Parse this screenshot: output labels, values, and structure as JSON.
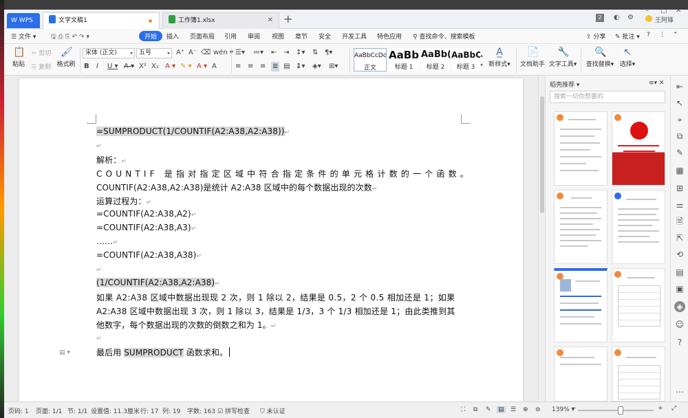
{
  "titlebar": {
    "app_tab": "WPS",
    "tabs": [
      {
        "label": "文字文稿1",
        "active": true
      },
      {
        "label": "工作簿1.xlsx",
        "active": false
      }
    ],
    "page_count_badge": "2",
    "user_name": "王阿锋"
  },
  "menubar": {
    "file_label": "文件",
    "items": [
      "开始",
      "插入",
      "页面布局",
      "引用",
      "审阅",
      "视图",
      "章节",
      "安全",
      "开发工具",
      "特色应用"
    ],
    "search_label": "查找命令、搜索模板",
    "share_label": "分享",
    "annotate_label": "批注"
  },
  "ribbon": {
    "paste_label": "粘贴",
    "cut_label": "剪切",
    "copy_label": "复制",
    "format_painter_label": "格式刷",
    "font_name": "宋体 (正文)",
    "font_size": "五号",
    "styles": [
      {
        "preview": "AaBbCcDd",
        "label": "正文"
      },
      {
        "preview": "AaBb",
        "label": "标题 1"
      },
      {
        "preview": "AaBb(",
        "label": "标题 2"
      },
      {
        "preview": "AaBbC(",
        "label": "标题 3"
      }
    ],
    "new_style_label": "新样式",
    "writing_assistant_label": "文档助手",
    "text_tools_label": "文字工具",
    "find_replace_label": "查找替换",
    "select_label": "选择"
  },
  "document": {
    "lines": [
      {
        "text": "=SUMPRODUCT(1/COUNTIF(A2:A38,A2:A38))",
        "highlight": true
      },
      {
        "text": "",
        "highlight": false
      },
      {
        "text": "解析：",
        "highlight": false
      },
      {
        "text": "COUNTIF 是指对指定区域中符合指定条件的单元格计数的一个函数。",
        "highlight": false,
        "justify": true
      },
      {
        "text": "COUNTIF(A2:A38,A2:A38)是统计 A2:A38 区域中的每个数据出现的次数",
        "highlight": false
      },
      {
        "text": "运算过程为：",
        "highlight": false
      },
      {
        "text": "=COUNTIF(A2:A38,A2)",
        "highlight": false
      },
      {
        "text": "=COUNTIF(A2:A38,A3)",
        "highlight": false
      },
      {
        "text": "……",
        "highlight": false
      },
      {
        "text": "=COUNTIF(A2:A38,A38)",
        "highlight": false
      },
      {
        "text": "",
        "highlight": false
      },
      {
        "text": "(1/COUNTIF(A2:A38,A2:A38)",
        "highlight": true
      },
      {
        "text": "如果 A2:A38 区域中数据出现现 2 次，则 1 除以 2，结果是 0.5，2 个 0.5 相加还是 1；如果",
        "highlight": false
      },
      {
        "text": "A2:A38 区域中数据出现 3 次，则 1 除以 3，结果是 1/3，3 个 1/3 相加还是 1；由此类推到其",
        "highlight": false
      },
      {
        "text": "他数字，每个数据出现的次数的倒数之和为 1。",
        "highlight": false
      },
      {
        "text": "",
        "highlight": false
      }
    ],
    "last_line_prefix": "最后用 ",
    "last_line_highlight": "SUMPRODUCT",
    "last_line_suffix": " 函数求和。"
  },
  "right_panel": {
    "title": "稻壳推荐",
    "search_placeholder": "搜索一切你想要的"
  },
  "statusbar": {
    "page": "页码: 1",
    "pages": "页面: 1/1",
    "section": "节: 1/1",
    "setting": "设置值: 11.3厘米",
    "row": "行: 17",
    "col": "列: 19",
    "word_count": "字数: 163",
    "spell_check": "拼写检查",
    "certify": "未认证",
    "zoom": "139%"
  }
}
